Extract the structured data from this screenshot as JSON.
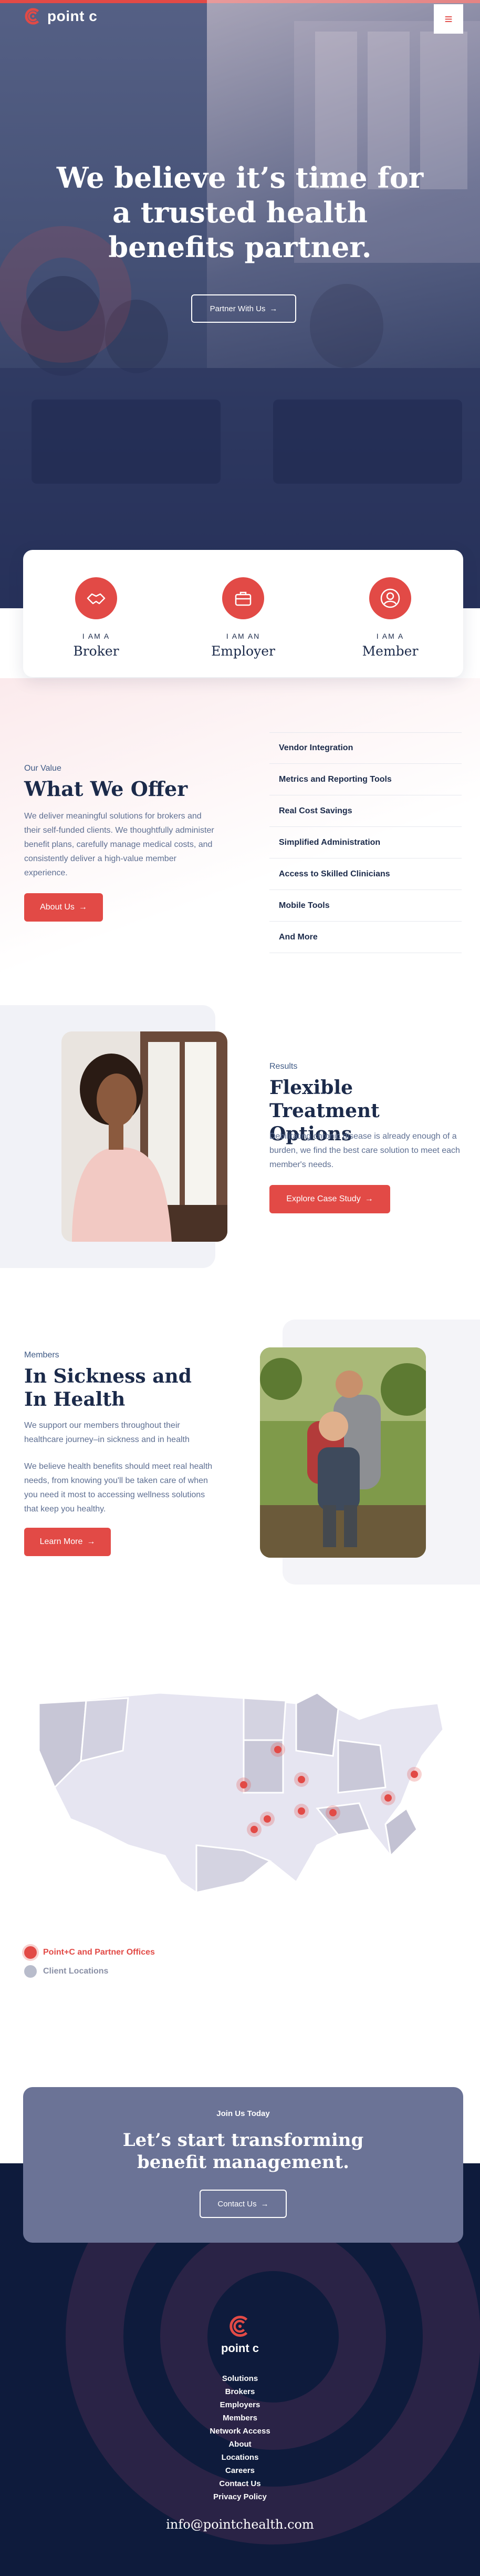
{
  "brand": {
    "name": "point c",
    "accent": "#e24a46",
    "navy": "#1b2a4a",
    "dark_footer": "#0e1b3c"
  },
  "header": {
    "menu_icon": "hamburger-icon",
    "menu_glyph": "≡"
  },
  "hero": {
    "title": "We believe it’s time for a trusted health benefits partner.",
    "button_label": "Partner With Us"
  },
  "personas": [
    {
      "eyebrow": "I AM A",
      "role": "Broker",
      "icon": "handshake-icon"
    },
    {
      "eyebrow": "I AM AN",
      "role": "Employer",
      "icon": "briefcase-icon"
    },
    {
      "eyebrow": "I AM A",
      "role": "Member",
      "icon": "user-icon"
    }
  ],
  "offer": {
    "eyebrow": "Our Value",
    "title": "What We Offer",
    "body": "We deliver meaningful solutions for brokers and their self-funded clients. We thoughtfully administer benefit plans, carefully manage medical costs, and consistently deliver a high-value member experience.",
    "button_label": "About Us",
    "list": [
      "Vendor Integration",
      "Metrics and Reporting Tools",
      "Real Cost Savings",
      "Simplified Administration",
      "Access to Skilled Clinicians",
      "Mobile Tools",
      "And More"
    ]
  },
  "results": {
    "eyebrow": "Results",
    "title": "Flexible Treatment Options",
    "body": "Debilitating chronic disease is already enough of a burden, we find the best care solution to meet each member's needs.",
    "button_label": "Explore Case Study"
  },
  "members": {
    "eyebrow": "Members",
    "title": "In Sickness and In Health",
    "body1": "We support our members throughout their healthcare journey–in sickness and in health",
    "body2": "We believe health benefits should meet real health needs, from knowing you'll be taken care of when you need it most to accessing wellness solutions that keep you healthy.",
    "button_label": "Learn More"
  },
  "map": {
    "legend": [
      {
        "label": "Point+C and Partner Offices",
        "color": "#e24a46"
      },
      {
        "label": "Client Locations",
        "color": "#b8bccb"
      }
    ]
  },
  "cta": {
    "eyebrow": "Join Us Today",
    "title": "Let’s start transforming benefit management.",
    "button_label": "Contact Us"
  },
  "footer": {
    "links": [
      "Solutions",
      "Brokers",
      "Employers",
      "Members",
      "Network Access",
      "About",
      "Locations",
      "Careers",
      "Contact Us",
      "Privacy Policy"
    ],
    "email": "info@pointchealth.com"
  },
  "icons": {
    "arrow": "→"
  }
}
